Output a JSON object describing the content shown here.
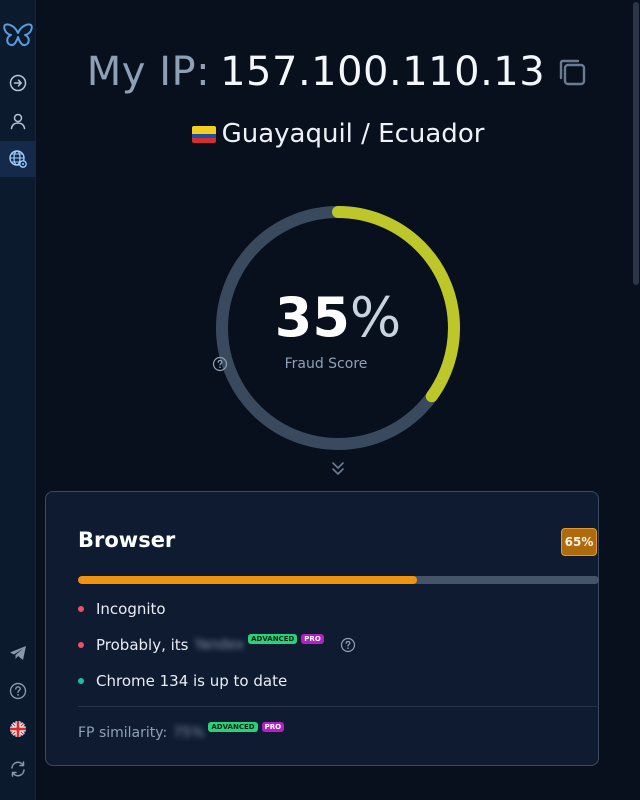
{
  "ip": {
    "label": "My IP:",
    "value": "157.100.110.13"
  },
  "location": {
    "text": "Guayaquil / Ecuador",
    "flag": "ecuador-flag"
  },
  "fraud_score": {
    "value": "35",
    "unit": "%",
    "label": "Fraud Score",
    "fraction": 0.35,
    "color": "#bec72a"
  },
  "browser_card": {
    "title": "Browser",
    "badge": "65%",
    "progress": 0.65,
    "items": [
      {
        "text": "Incognito",
        "status": "red"
      },
      {
        "text": "Probably, its",
        "blurred": "Yandex",
        "tags": [
          "ADVANCED",
          "PRO"
        ],
        "status": "red"
      },
      {
        "text": "Chrome 134 is up to date",
        "status": "green"
      }
    ],
    "fp_similarity": {
      "label": "FP similarity:",
      "blurred": "75%",
      "tags": [
        "ADVANCED",
        "PRO"
      ]
    }
  },
  "colors": {
    "accent": "#f0940f",
    "gauge_track": "#3a4a5e",
    "gauge_fill": "#bec72a",
    "background": "#08101d"
  },
  "icons": {
    "sidebar_top": [
      "butterfly-logo-icon",
      "arrow-right-circle-icon",
      "user-icon",
      "globe-settings-icon"
    ],
    "sidebar_bottom": [
      "telegram-icon",
      "help-circle-icon",
      "uk-flag-icon",
      "refresh-icon"
    ]
  }
}
